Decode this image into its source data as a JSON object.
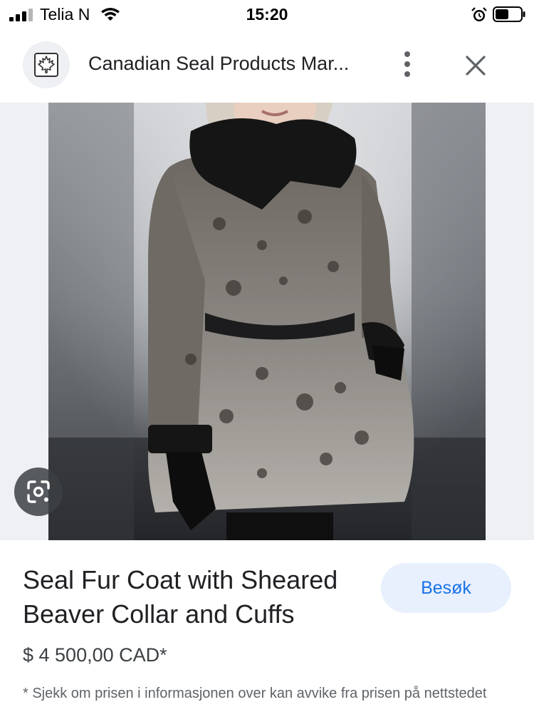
{
  "status_bar": {
    "carrier": "Telia N",
    "time": "15:20",
    "icons": [
      "signal-icon",
      "wifi-icon",
      "alarm-icon",
      "battery-icon"
    ]
  },
  "header": {
    "site_title": "Canadian Seal Products Mar...",
    "logo_icon": "maple-leaf-icon",
    "menu_icon": "more-vertical-icon",
    "close_icon": "close-icon"
  },
  "image": {
    "lens_icon": "google-lens-icon"
  },
  "product": {
    "title": "Seal Fur Coat with Sheared Beaver Collar and Cuffs",
    "price": "$ 4 500,00 CAD*",
    "visit_label": "Besøk",
    "disclaimer": "* Sjekk om prisen i informasjonen over kan avvike fra prisen på nettstedet"
  },
  "colors": {
    "accent": "#1a73e8",
    "button_bg": "#e8f0fe",
    "image_bg": "#eef0f3",
    "text": "#202124"
  }
}
